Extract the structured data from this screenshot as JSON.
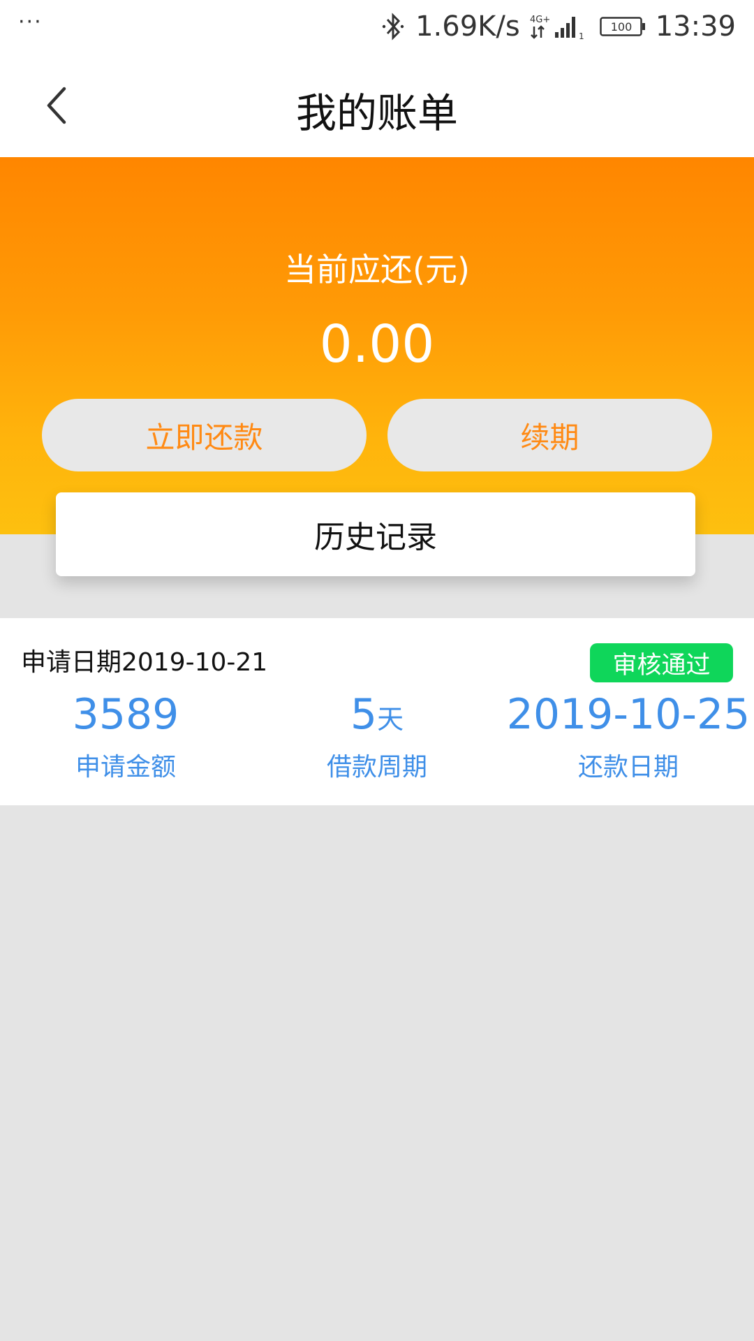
{
  "status_bar": {
    "dots": "···",
    "speed": "1.69K/s",
    "network": "4G+",
    "battery": "100",
    "time": "13:39"
  },
  "header": {
    "title": "我的账单"
  },
  "hero": {
    "label": "当前应还(元)",
    "amount": "0.00",
    "repay_button": "立即还款",
    "renew_button": "续期",
    "history_button": "历史记录"
  },
  "bill": {
    "apply_date": "申请日期2019-10-21",
    "status": "审核通过",
    "amount_value": "3589",
    "amount_label": "申请金额",
    "period_value": "5",
    "period_unit": "天",
    "period_label": "借款周期",
    "due_value": "2019-10-25",
    "due_label": "还款日期"
  },
  "colors": {
    "accent_orange": "#ff8a14",
    "hero_top": "#ff8600",
    "hero_bottom": "#fdc00f",
    "stat_blue": "#3f8fe8",
    "badge_green": "#0fd65a"
  }
}
